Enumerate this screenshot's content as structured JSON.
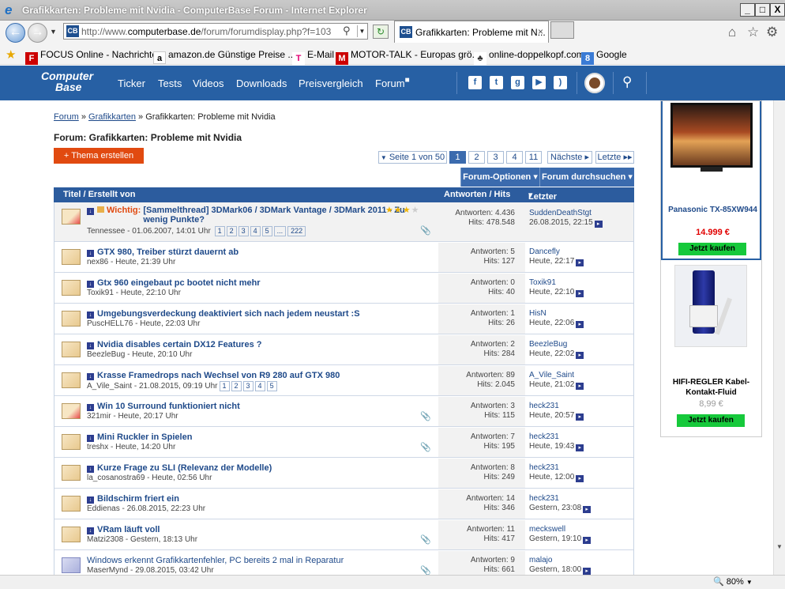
{
  "window": {
    "title": "Grafikkarten: Probleme mit Nvidia - ComputerBase Forum - Internet Explorer",
    "minimize": "_",
    "maximize": "□",
    "close": "X"
  },
  "address": {
    "url_prefix": "http://www.",
    "url_domain": "computerbase.de",
    "url_path": "/forum/forumdisplay.php?f=103",
    "favicon": "CB"
  },
  "tab": {
    "label": "Grafikkarten: Probleme mit N...",
    "close": "×",
    "favicon": "CB"
  },
  "favorites": [
    {
      "label": "FOCUS Online - Nachrichten",
      "icon": "focus-icon"
    },
    {
      "label": "amazon.de Günstige Preise ...",
      "icon": "amazon-icon"
    },
    {
      "label": "E-Mail",
      "icon": "telekom-icon"
    },
    {
      "label": "MOTOR-TALK - Europas grö...",
      "icon": "motortalk-icon"
    },
    {
      "label": "online-doppelkopf.com",
      "icon": "doppelkopf-icon"
    },
    {
      "label": "Google",
      "icon": "google-icon"
    }
  ],
  "site": {
    "logo_line1": "Computer",
    "logo_line2": "Base",
    "nav": [
      "Ticker",
      "Tests",
      "Videos",
      "Downloads",
      "Preisvergleich",
      "Forum"
    ]
  },
  "breadcrumb": {
    "forum": "Forum",
    "sep1": "»",
    "cat": "Grafikkarten",
    "sep2": "»",
    "current": "Grafikkarten: Probleme mit Nvidia"
  },
  "heading": "Forum: Grafikkarten: Probleme mit Nvidia",
  "new_thread": "+ Thema erstellen",
  "pager": {
    "label": "Seite 1 von 50",
    "pages": [
      "1",
      "2",
      "3",
      "4",
      "11"
    ],
    "next": "Nächste",
    "last": "Letzte"
  },
  "options": {
    "forum_options": "Forum-Optionen",
    "search": "Forum durchsuchen"
  },
  "columns": {
    "title": "Titel / Erstellt von",
    "replies": "Antworten / Hits",
    "last": "Letzter Beitrag von"
  },
  "threads": [
    {
      "prefix": "Wichtig:",
      "title": "[Sammelthread] 3DMark06 / 3DMark Vantage / 3DMark 2011 - Zu wenig Punkte?",
      "author_date": "Tennessee - 01.06.2007, 14:01 Uhr",
      "pages": [
        "1",
        "2",
        "3",
        "4",
        "5",
        "...",
        "222"
      ],
      "replies": "Antworten: 4.436",
      "hits": "Hits: 478.548",
      "last_user": "SuddenDeathStgt",
      "last_date": "26.08.2015, 22:15"
    },
    {
      "title": "GTX 980, Treiber stürzt dauernt ab",
      "author_date": "nex86 - Heute, 21:39 Uhr",
      "replies": "Antworten: 5",
      "hits": "Hits: 127",
      "last_user": "Dancefly",
      "last_date": "Heute, 22:17"
    },
    {
      "title": "Gtx 960 eingebaut pc bootet nicht mehr",
      "author_date": "Toxik91 - Heute, 22:10 Uhr",
      "replies": "Antworten: 0",
      "hits": "Hits: 40",
      "last_user": "Toxik91",
      "last_date": "Heute, 22:10"
    },
    {
      "title": "Umgebungsverdeckung deaktiviert sich nach jedem neustart :S",
      "author_date": "PuscHELL76 - Heute, 22:03 Uhr",
      "replies": "Antworten: 1",
      "hits": "Hits: 26",
      "last_user": "HisN",
      "last_date": "Heute, 22:06"
    },
    {
      "title": "Nvidia disables certain DX12 Features ?",
      "author_date": "BeezleBug - Heute, 20:10 Uhr",
      "replies": "Antworten: 2",
      "hits": "Hits: 284",
      "last_user": "BeezleBug",
      "last_date": "Heute, 22:02"
    },
    {
      "title": "Krasse Framedrops nach Wechsel von R9 280 auf GTX 980",
      "author_date": "A_Vile_Saint - 21.08.2015, 09:19 Uhr",
      "pages": [
        "1",
        "2",
        "3",
        "4",
        "5"
      ],
      "replies": "Antworten: 89",
      "hits": "Hits: 2.045",
      "last_user": "A_Vile_Saint",
      "last_date": "Heute, 21:02"
    },
    {
      "title": "Win 10 Surround funktioniert nicht",
      "author_date": "321mir - Heute, 20:17 Uhr",
      "replies": "Antworten: 3",
      "hits": "Hits: 115",
      "last_user": "heck231",
      "last_date": "Heute, 20:57"
    },
    {
      "title": "Mini Ruckler in Spielen",
      "author_date": "treshx - Heute, 14:20 Uhr",
      "replies": "Antworten: 7",
      "hits": "Hits: 195",
      "last_user": "heck231",
      "last_date": "Heute, 19:43"
    },
    {
      "title": "Kurze Frage zu SLI (Relevanz der Modelle)",
      "author_date": "la_cosanostra69 - Heute, 02:56 Uhr",
      "replies": "Antworten: 8",
      "hits": "Hits: 249",
      "last_user": "heck231",
      "last_date": "Heute, 12:00"
    },
    {
      "title": "Bildschirm friert ein",
      "author_date": "Eddienas - 26.08.2015, 22:23 Uhr",
      "replies": "Antworten: 14",
      "hits": "Hits: 346",
      "last_user": "heck231",
      "last_date": "Gestern, 23:08"
    },
    {
      "title": "VRam läuft voll",
      "author_date": "Matzi2308 - Gestern, 18:13 Uhr",
      "replies": "Antworten: 11",
      "hits": "Hits: 417",
      "last_user": "meckswell",
      "last_date": "Gestern, 19:10"
    },
    {
      "title": "Windows erkennt Grafikkartenfehler, PC bereits 2 mal in Reparatur",
      "author_date": "MaserMynd - 29.08.2015, 03:42 Uhr",
      "replies": "Antworten: 9",
      "hits": "Hits: 661",
      "last_user": "malajo",
      "last_date": "Gestern, 18:00"
    }
  ],
  "ad": {
    "product1": "Panasonic TX-85XW944",
    "price1": "14.999 €",
    "buy1": "Jetzt kaufen",
    "product2": "HIFI-REGLER Kabel-Kontakt-Fluid",
    "price2": "8,99 €",
    "buy2": "Jetzt kaufen"
  },
  "status": {
    "zoom": "80%"
  }
}
